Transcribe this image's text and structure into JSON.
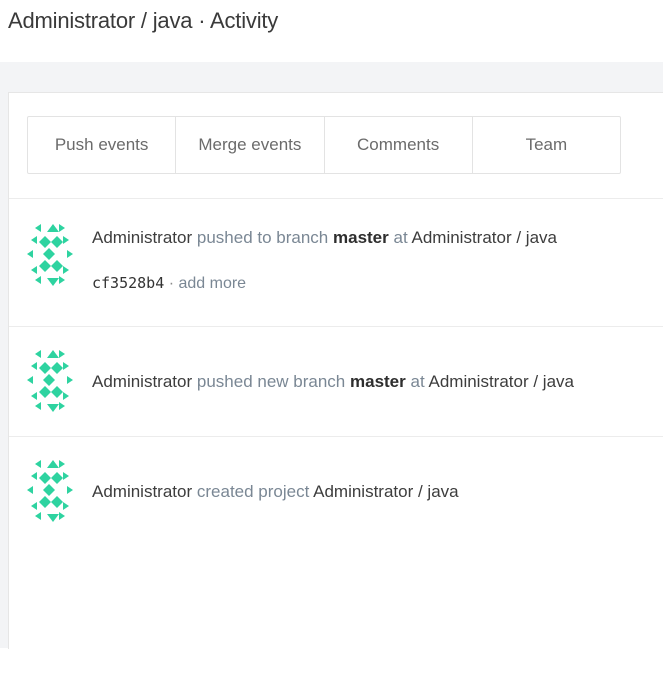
{
  "header": {
    "title": "Administrator / java · Activity"
  },
  "filters": [
    {
      "label": "Push events"
    },
    {
      "label": "Merge events"
    },
    {
      "label": "Comments"
    },
    {
      "label": "Team"
    }
  ],
  "events": [
    {
      "author": "Administrator",
      "action": "pushed to branch",
      "ref": "master",
      "connector": "at",
      "project": "Administrator / java",
      "commit_sha": "cf3528b4",
      "separator": "·",
      "more_label": "add more"
    },
    {
      "author": "Administrator",
      "action": "pushed new branch",
      "ref": "master",
      "connector": "at",
      "project": "Administrator / java"
    },
    {
      "author": "Administrator",
      "action": "created project",
      "project": "Administrator / java"
    }
  ],
  "colors": {
    "avatar": "#2ed3a0",
    "muted_text": "#7a8794",
    "page_band": "#f3f4f6"
  },
  "icons": {
    "avatar": "identicon-avatar-icon"
  }
}
